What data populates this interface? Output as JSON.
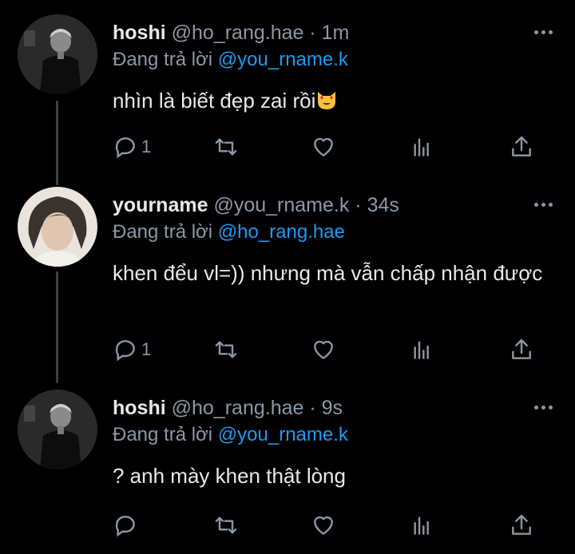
{
  "colors": {
    "background": "#000000",
    "text": "#e7e9ea",
    "muted": "#8b98a5",
    "mention": "#1d9bf0",
    "thread_line": "#3e4144"
  },
  "reply_prefix": "Đang trả lời",
  "tweets": [
    {
      "name": "hoshi",
      "handle": "@ho_rang.hae",
      "time": "· 1m",
      "reply_to": "@you_rname.k",
      "text": "nhìn là biết đẹp zai rồi",
      "emoji": "heart-eyes-cat-emoji",
      "avatar": "hoshi-avatar",
      "reply_count": "1"
    },
    {
      "name": "yourname",
      "handle": "@you_rname.k",
      "time": "· 34s",
      "reply_to": "@ho_rang.hae",
      "text": "khen đểu vl=)) nhưng mà vẫn chấp nhận được",
      "avatar": "yourname-avatar",
      "reply_count": "1"
    },
    {
      "name": "hoshi",
      "handle": "@ho_rang.hae",
      "time": "· 9s",
      "reply_to": "@you_rname.k",
      "text": "? anh mày khen thật lòng",
      "avatar": "hoshi-avatar",
      "reply_count": ""
    }
  ],
  "action_icons": [
    "reply-icon",
    "retweet-icon",
    "like-icon",
    "analytics-icon",
    "share-icon"
  ]
}
